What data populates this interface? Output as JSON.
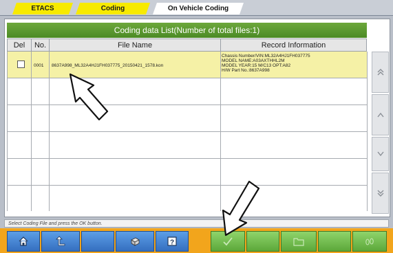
{
  "tabs": [
    {
      "label": "ETACS"
    },
    {
      "label": "Coding"
    },
    {
      "label": "On Vehicle Coding"
    }
  ],
  "list": {
    "title": "Coding data List(Number of total files:1)",
    "columns": [
      "Del",
      "No.",
      "File Name",
      "Record Information"
    ],
    "rows": [
      {
        "no": "0001",
        "file_name": "8637A998_ML32A4HJ1FH037775_20150421_1578.kon",
        "record_info": [
          "Chassis Number/VIN:ML32A4HJ1FH037775",
          "MODEL NAME:A03AXTHHL2M",
          "MODEL YEAR:15 M/C13 OPT:A82",
          "H/W Part No.:8637A998"
        ]
      }
    ]
  },
  "status": "Select Coding File and press the OK button.",
  "colors": {
    "title_bar": "#5a9a2e",
    "selected_row": "#f5f1a6",
    "bottom_bar": "#f2a51c",
    "button_blue": "#3f7fcf",
    "button_green": "#7cc457",
    "tab_yellow": "#f7ea00"
  },
  "icons": {
    "home": "home-icon",
    "back": "back-arrow-icon",
    "printer": "printer-icon",
    "help": "help-icon",
    "ok": "checkmark-icon",
    "folder": "folder-icon",
    "footprint": "footprint-icon",
    "scroll_top": "scroll-top-icon",
    "scroll_up": "scroll-up-icon",
    "scroll_down": "scroll-down-icon",
    "scroll_bottom": "scroll-bottom-icon"
  }
}
